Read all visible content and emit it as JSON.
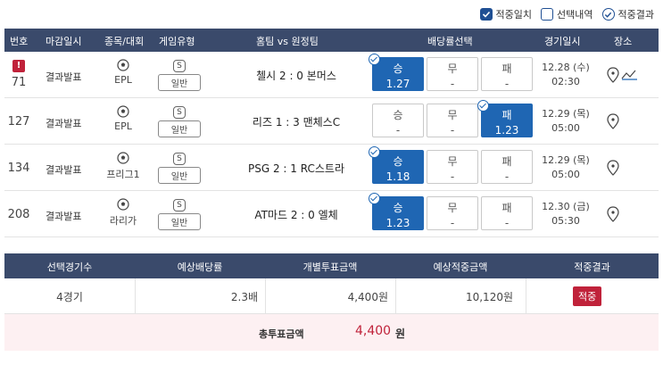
{
  "legend": [
    {
      "label": "적중일치",
      "state": "checked"
    },
    {
      "label": "선택내역",
      "state": "empty"
    },
    {
      "label": "적중결과",
      "state": "circle"
    }
  ],
  "header": {
    "no": "번호",
    "deadline": "마감일시",
    "sport": "종목/대회",
    "game_type": "게임유형",
    "teams": "홈팀 vs 원정팀",
    "odds": "배당률선택",
    "date": "경기일시",
    "place": "장소"
  },
  "rows": [
    {
      "no": "71",
      "flag": "!",
      "deadline": "결과발표",
      "league": "EPL",
      "s_badge": "S",
      "type": "일반",
      "match": "첼시 2 : 0 본머스",
      "odds": [
        {
          "label": "승",
          "value": "1.27"
        },
        {
          "label": "무",
          "value": "-"
        },
        {
          "label": "패",
          "value": "-"
        }
      ],
      "date": "12.28 (수)",
      "time": "02:30"
    },
    {
      "no": "127",
      "deadline": "결과발표",
      "league": "EPL",
      "s_badge": "S",
      "type": "일반",
      "match": "리즈 1 : 3 맨체스C",
      "odds": [
        {
          "label": "승",
          "value": "-"
        },
        {
          "label": "무",
          "value": "-"
        },
        {
          "label": "패",
          "value": "1.23"
        }
      ],
      "date": "12.29 (목)",
      "time": "05:00"
    },
    {
      "no": "134",
      "deadline": "결과발표",
      "league": "프리그1",
      "s_badge": "S",
      "type": "일반",
      "match": "PSG 2 : 1 RC스트라",
      "odds": [
        {
          "label": "승",
          "value": "1.18"
        },
        {
          "label": "무",
          "value": "-"
        },
        {
          "label": "패",
          "value": "-"
        }
      ],
      "date": "12.29 (목)",
      "time": "05:00"
    },
    {
      "no": "208",
      "deadline": "결과발표",
      "league": "라리가",
      "s_badge": "S",
      "type": "일반",
      "match": "AT마드 2 : 0 엘체",
      "odds": [
        {
          "label": "승",
          "value": "1.23"
        },
        {
          "label": "무",
          "value": "-"
        },
        {
          "label": "패",
          "value": "-"
        }
      ],
      "date": "12.30 (금)",
      "time": "05:30"
    }
  ],
  "summary": {
    "headers": [
      "선택경기수",
      "예상배당률",
      "개별투표금액",
      "예상적중금액",
      "적중결과"
    ],
    "values": {
      "count": "4경기",
      "odds": "2.3배",
      "bet": "4,400원",
      "expected": "10,120원",
      "result": "적중"
    },
    "total_label": "총투표금액",
    "total_amount": "4,400",
    "total_unit": "원"
  },
  "colors": {
    "header_bg": "#3a4a6b",
    "selected_odd": "#1f66b3",
    "hit_badge": "#c0223a",
    "total_bg": "#fdf0f2"
  }
}
